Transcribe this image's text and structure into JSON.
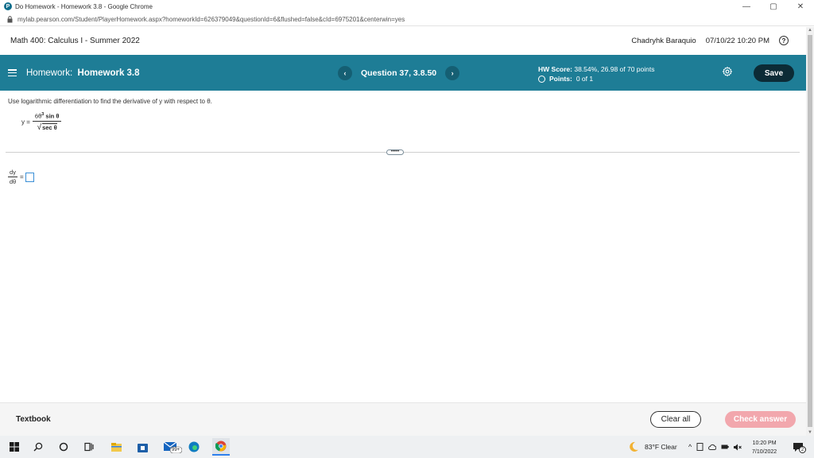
{
  "browser": {
    "title": "Do Homework - Homework 3.8 - Google Chrome",
    "url": "mylab.pearson.com/Student/PlayerHomework.aspx?homeworkId=626379049&questionId=6&flushed=false&cId=6975201&centerwin=yes",
    "controls": {
      "minimize": "—",
      "restore": "▢",
      "close": "✕"
    }
  },
  "course": {
    "name": "Math 400: Calculus I - Summer 2022",
    "user": "Chadryhk Baraquio",
    "datetime": "07/10/22 10:20 PM"
  },
  "homework": {
    "label": "Homework:",
    "name": "Homework 3.8",
    "question": "Question 37, 3.8.50",
    "score_label": "HW Score:",
    "score_value": "38.54%, 26.98 of 70 points",
    "points_label": "Points:",
    "points_value": "0 of 1",
    "save": "Save"
  },
  "question": {
    "prompt": "Use logarithmic differentiation to find the derivative of y with respect to θ.",
    "y_label": "y =",
    "numerator_coef": "6θ",
    "numerator_exp": "3",
    "numerator_fn": "sin θ",
    "denominator": "sec θ",
    "more_label": "•••••",
    "deriv_num": "dy",
    "deriv_den": "dθ",
    "equals": "="
  },
  "footer": {
    "textbook": "Textbook",
    "clear_all": "Clear all",
    "check_answer": "Check answer"
  },
  "taskbar": {
    "weather": "83°F  Clear",
    "time": "10:20 PM",
    "date": "7/10/2022",
    "mail_badge": "99+",
    "notif_count": "2"
  },
  "colors": {
    "accent": "#1e7d96",
    "save_bg": "#0c2b36",
    "check_bg": "#f2a7ad",
    "answer_border": "#3a8fd6"
  }
}
